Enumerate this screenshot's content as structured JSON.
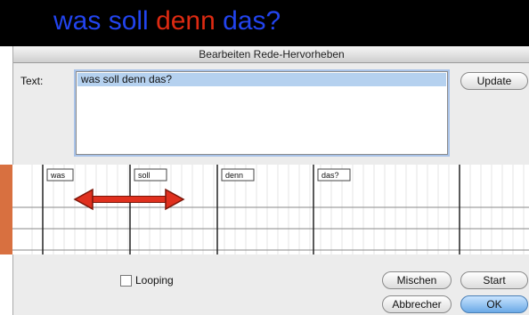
{
  "banner": {
    "words": [
      {
        "text": "was",
        "color": "#2244ee"
      },
      {
        "text": "soll",
        "color": "#2244ee"
      },
      {
        "text": "denn",
        "color": "#dd2a12"
      },
      {
        "text": "das?",
        "color": "#2244ee"
      }
    ]
  },
  "dialog": {
    "title": "Bearbeiten Rede-Hervorheben",
    "text_label": "Text:",
    "text_value": "was soll denn das?",
    "update_label": "Update",
    "timeline_words": [
      "was",
      "soll",
      "denn",
      "das?"
    ],
    "looping_label": "Looping",
    "looping_checked": false,
    "mischen_label": "Mischen",
    "start_label": "Start",
    "abbrechen_label": "Abbrecher",
    "ok_label": "OK"
  },
  "colors": {
    "arrow": "#e0301e",
    "accent": "#6ba9e6"
  }
}
